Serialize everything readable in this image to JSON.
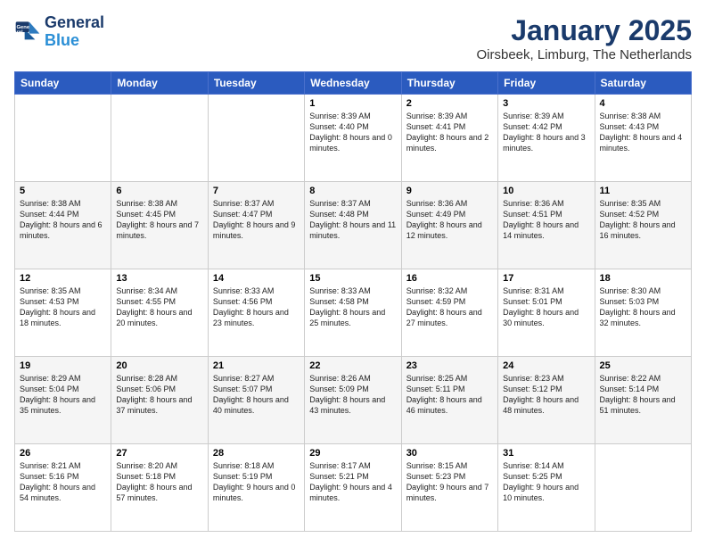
{
  "logo": {
    "line1": "General",
    "line2": "Blue"
  },
  "header": {
    "title": "January 2025",
    "location": "Oirsbeek, Limburg, The Netherlands"
  },
  "days_of_week": [
    "Sunday",
    "Monday",
    "Tuesday",
    "Wednesday",
    "Thursday",
    "Friday",
    "Saturday"
  ],
  "weeks": [
    [
      {
        "day": "",
        "content": ""
      },
      {
        "day": "",
        "content": ""
      },
      {
        "day": "",
        "content": ""
      },
      {
        "day": "1",
        "content": "Sunrise: 8:39 AM\nSunset: 4:40 PM\nDaylight: 8 hours and 0 minutes."
      },
      {
        "day": "2",
        "content": "Sunrise: 8:39 AM\nSunset: 4:41 PM\nDaylight: 8 hours and 2 minutes."
      },
      {
        "day": "3",
        "content": "Sunrise: 8:39 AM\nSunset: 4:42 PM\nDaylight: 8 hours and 3 minutes."
      },
      {
        "day": "4",
        "content": "Sunrise: 8:38 AM\nSunset: 4:43 PM\nDaylight: 8 hours and 4 minutes."
      }
    ],
    [
      {
        "day": "5",
        "content": "Sunrise: 8:38 AM\nSunset: 4:44 PM\nDaylight: 8 hours and 6 minutes."
      },
      {
        "day": "6",
        "content": "Sunrise: 8:38 AM\nSunset: 4:45 PM\nDaylight: 8 hours and 7 minutes."
      },
      {
        "day": "7",
        "content": "Sunrise: 8:37 AM\nSunset: 4:47 PM\nDaylight: 8 hours and 9 minutes."
      },
      {
        "day": "8",
        "content": "Sunrise: 8:37 AM\nSunset: 4:48 PM\nDaylight: 8 hours and 11 minutes."
      },
      {
        "day": "9",
        "content": "Sunrise: 8:36 AM\nSunset: 4:49 PM\nDaylight: 8 hours and 12 minutes."
      },
      {
        "day": "10",
        "content": "Sunrise: 8:36 AM\nSunset: 4:51 PM\nDaylight: 8 hours and 14 minutes."
      },
      {
        "day": "11",
        "content": "Sunrise: 8:35 AM\nSunset: 4:52 PM\nDaylight: 8 hours and 16 minutes."
      }
    ],
    [
      {
        "day": "12",
        "content": "Sunrise: 8:35 AM\nSunset: 4:53 PM\nDaylight: 8 hours and 18 minutes."
      },
      {
        "day": "13",
        "content": "Sunrise: 8:34 AM\nSunset: 4:55 PM\nDaylight: 8 hours and 20 minutes."
      },
      {
        "day": "14",
        "content": "Sunrise: 8:33 AM\nSunset: 4:56 PM\nDaylight: 8 hours and 23 minutes."
      },
      {
        "day": "15",
        "content": "Sunrise: 8:33 AM\nSunset: 4:58 PM\nDaylight: 8 hours and 25 minutes."
      },
      {
        "day": "16",
        "content": "Sunrise: 8:32 AM\nSunset: 4:59 PM\nDaylight: 8 hours and 27 minutes."
      },
      {
        "day": "17",
        "content": "Sunrise: 8:31 AM\nSunset: 5:01 PM\nDaylight: 8 hours and 30 minutes."
      },
      {
        "day": "18",
        "content": "Sunrise: 8:30 AM\nSunset: 5:03 PM\nDaylight: 8 hours and 32 minutes."
      }
    ],
    [
      {
        "day": "19",
        "content": "Sunrise: 8:29 AM\nSunset: 5:04 PM\nDaylight: 8 hours and 35 minutes."
      },
      {
        "day": "20",
        "content": "Sunrise: 8:28 AM\nSunset: 5:06 PM\nDaylight: 8 hours and 37 minutes."
      },
      {
        "day": "21",
        "content": "Sunrise: 8:27 AM\nSunset: 5:07 PM\nDaylight: 8 hours and 40 minutes."
      },
      {
        "day": "22",
        "content": "Sunrise: 8:26 AM\nSunset: 5:09 PM\nDaylight: 8 hours and 43 minutes."
      },
      {
        "day": "23",
        "content": "Sunrise: 8:25 AM\nSunset: 5:11 PM\nDaylight: 8 hours and 46 minutes."
      },
      {
        "day": "24",
        "content": "Sunrise: 8:23 AM\nSunset: 5:12 PM\nDaylight: 8 hours and 48 minutes."
      },
      {
        "day": "25",
        "content": "Sunrise: 8:22 AM\nSunset: 5:14 PM\nDaylight: 8 hours and 51 minutes."
      }
    ],
    [
      {
        "day": "26",
        "content": "Sunrise: 8:21 AM\nSunset: 5:16 PM\nDaylight: 8 hours and 54 minutes."
      },
      {
        "day": "27",
        "content": "Sunrise: 8:20 AM\nSunset: 5:18 PM\nDaylight: 8 hours and 57 minutes."
      },
      {
        "day": "28",
        "content": "Sunrise: 8:18 AM\nSunset: 5:19 PM\nDaylight: 9 hours and 0 minutes."
      },
      {
        "day": "29",
        "content": "Sunrise: 8:17 AM\nSunset: 5:21 PM\nDaylight: 9 hours and 4 minutes."
      },
      {
        "day": "30",
        "content": "Sunrise: 8:15 AM\nSunset: 5:23 PM\nDaylight: 9 hours and 7 minutes."
      },
      {
        "day": "31",
        "content": "Sunrise: 8:14 AM\nSunset: 5:25 PM\nDaylight: 9 hours and 10 minutes."
      },
      {
        "day": "",
        "content": ""
      }
    ]
  ]
}
